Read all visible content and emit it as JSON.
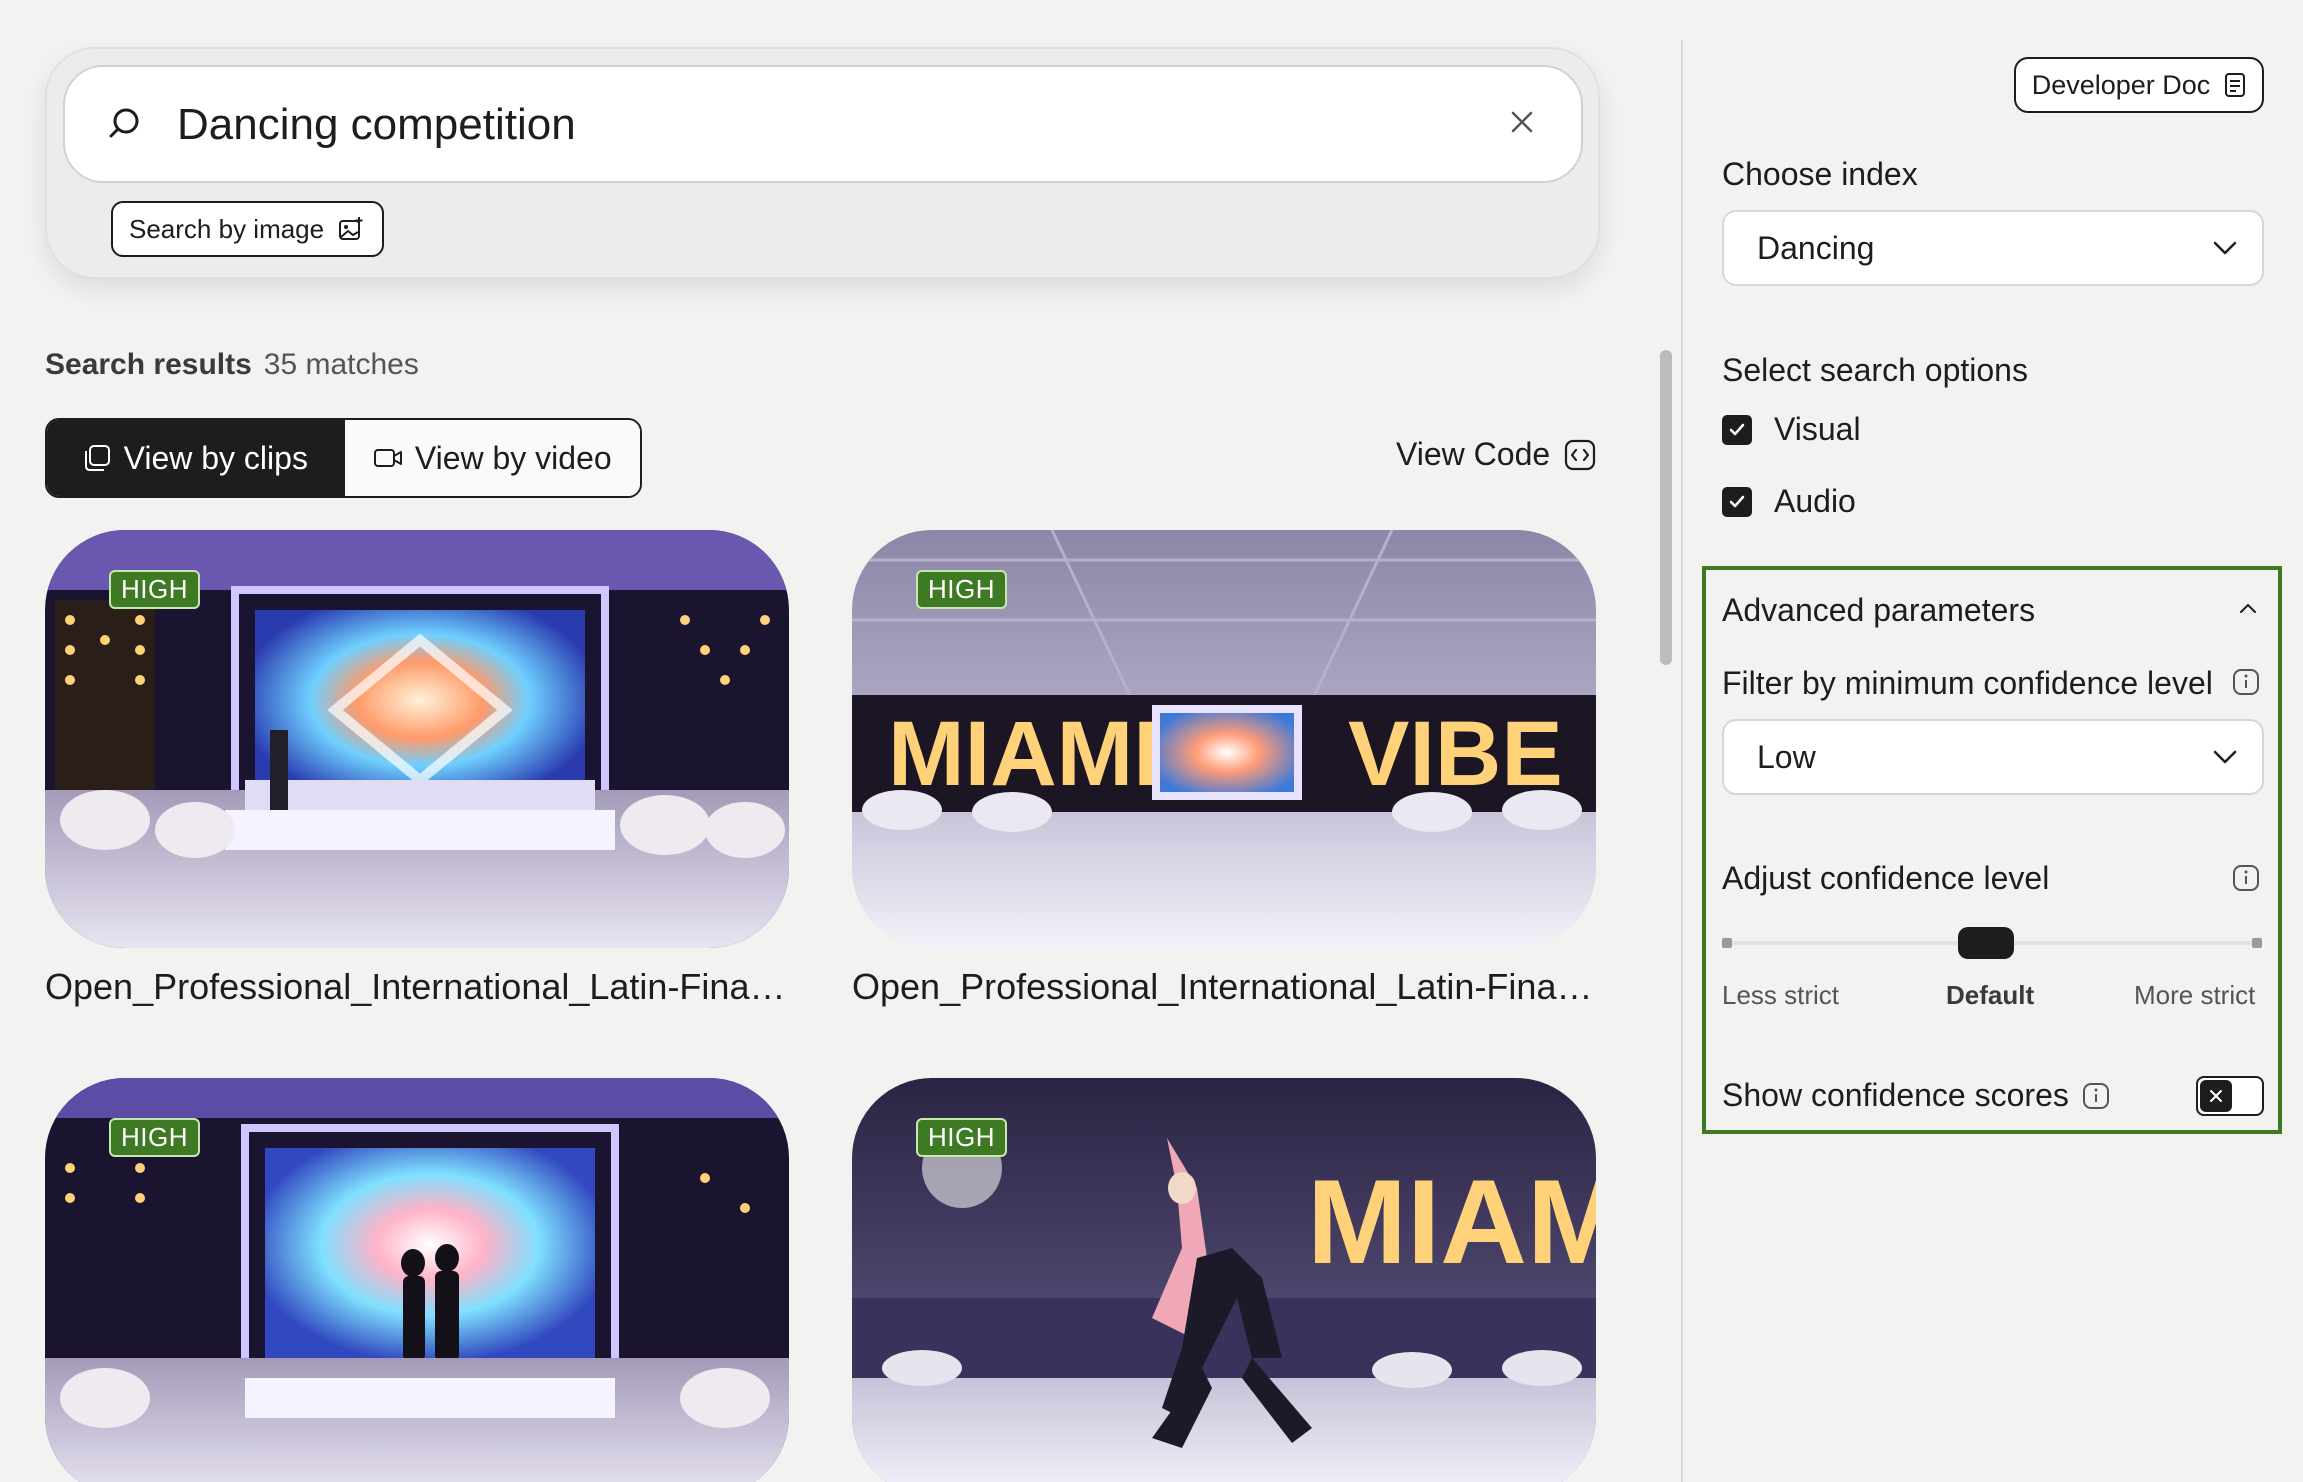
{
  "search": {
    "query": "Dancing competition",
    "image_search_label": "Search by image"
  },
  "results": {
    "title": "Search results",
    "count": "35 matches",
    "view_by_clips": "View by clips",
    "view_by_video": "View by video",
    "view_code": "View Code",
    "clips": [
      {
        "badge": "HIGH",
        "title": "Open_Professional_International_Latin-Final_P..."
      },
      {
        "badge": "HIGH",
        "title": "Open_Professional_International_Latin-Final_P..."
      },
      {
        "badge": "HIGH",
        "title": ""
      },
      {
        "badge": "HIGH",
        "title": ""
      }
    ]
  },
  "sidebar": {
    "developer_doc": "Developer Doc",
    "choose_index_label": "Choose index",
    "index_value": "Dancing",
    "search_options_label": "Select search options",
    "options": [
      {
        "label": "Visual",
        "checked": true
      },
      {
        "label": "Audio",
        "checked": true
      }
    ],
    "advanced": {
      "title": "Advanced parameters",
      "filter_label": "Filter by minimum confidence level",
      "filter_value": "Low",
      "adjust_label": "Adjust confidence level",
      "slider_labels": {
        "left": "Less strict",
        "middle": "Default",
        "right": "More strict"
      },
      "slider_value": "Default",
      "show_scores_label": "Show confidence scores",
      "show_scores_enabled": false
    }
  },
  "colors": {
    "accent_green": "#3e7a23",
    "dark": "#1d1d1b",
    "background": "#f2f2f1"
  }
}
